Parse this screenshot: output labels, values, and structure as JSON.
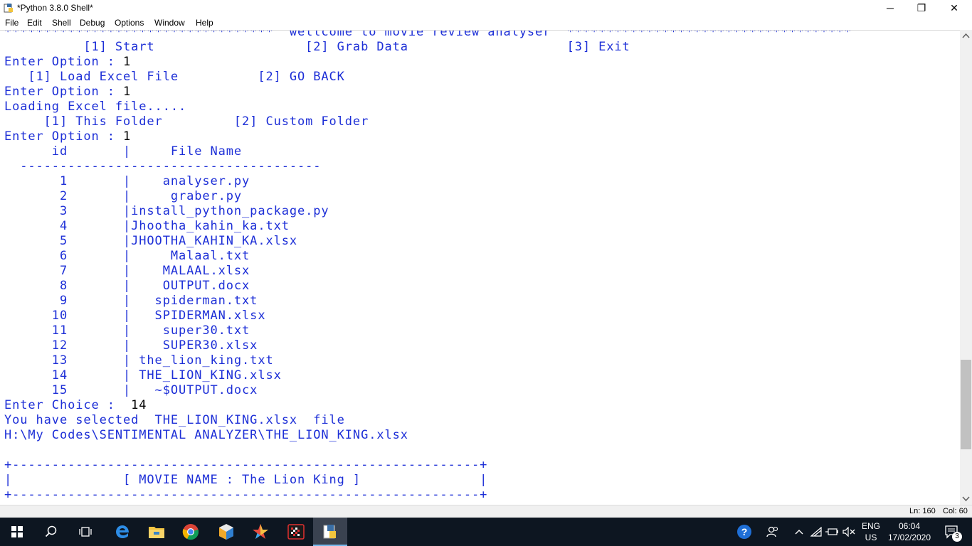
{
  "window": {
    "title": "*Python 3.8.0 Shell*",
    "minimize_glyph": "─",
    "maximize_glyph": "❐",
    "close_glyph": "✕"
  },
  "menu": [
    "File",
    "Edit",
    "Shell",
    "Debug",
    "Options",
    "Window",
    "Help"
  ],
  "shell_lines": [
    {
      "text": "**********************************  wellcome to movie review analyser  ************************************",
      "kind": "out"
    },
    {
      "text": "          [1] Start                   [2] Grab Data                    [3] Exit",
      "kind": "out"
    },
    {
      "text": "Enter Option : ",
      "input": "1",
      "kind": "out"
    },
    {
      "text": "   [1] Load Excel File          [2] GO BACK",
      "kind": "out"
    },
    {
      "text": "Enter Option : ",
      "input": "1",
      "kind": "out"
    },
    {
      "text": "Loading Excel file.....",
      "kind": "out"
    },
    {
      "text": "     [1] This Folder         [2] Custom Folder",
      "kind": "out"
    },
    {
      "text": "Enter Option : ",
      "input": "1",
      "kind": "out"
    },
    {
      "text": "      id       |     File Name",
      "kind": "out"
    },
    {
      "text": "  --------------------------------------",
      "kind": "out"
    },
    {
      "text": "       1       |    analyser.py",
      "kind": "out"
    },
    {
      "text": "       2       |     graber.py",
      "kind": "out"
    },
    {
      "text": "       3       |install_python_package.py",
      "kind": "out"
    },
    {
      "text": "       4       |Jhootha_kahin_ka.txt",
      "kind": "out"
    },
    {
      "text": "       5       |JHOOTHA_KAHIN_KA.xlsx",
      "kind": "out"
    },
    {
      "text": "       6       |     Malaal.txt",
      "kind": "out"
    },
    {
      "text": "       7       |    MALAAL.xlsx",
      "kind": "out"
    },
    {
      "text": "       8       |    OUTPUT.docx",
      "kind": "out"
    },
    {
      "text": "       9       |   spiderman.txt",
      "kind": "out"
    },
    {
      "text": "      10       |   SPIDERMAN.xlsx",
      "kind": "out"
    },
    {
      "text": "      11       |    super30.txt",
      "kind": "out"
    },
    {
      "text": "      12       |    SUPER30.xlsx",
      "kind": "out"
    },
    {
      "text": "      13       | the_lion_king.txt",
      "kind": "out"
    },
    {
      "text": "      14       | THE_LION_KING.xlsx",
      "kind": "out"
    },
    {
      "text": "      15       |   ~$OUTPUT.docx",
      "kind": "out"
    },
    {
      "text": "Enter Choice :  ",
      "input": "14",
      "kind": "out"
    },
    {
      "text": "You have selected  THE_LION_KING.xlsx  file",
      "kind": "out"
    },
    {
      "text": "H:\\My Codes\\SENTIMENTAL ANALYZER\\THE_LION_KING.xlsx",
      "kind": "out"
    },
    {
      "text": "",
      "kind": "out"
    },
    {
      "text": "+-----------------------------------------------------------+",
      "kind": "out"
    },
    {
      "text": "|              [ MOVIE NAME : The Lion King ]               |",
      "kind": "out"
    },
    {
      "text": "+-----------------------------------------------------------+",
      "kind": "out"
    }
  ],
  "status": {
    "ln": "Ln: 160",
    "col": "Col: 60"
  },
  "taskbar": {
    "icons": [
      "windows-start-icon",
      "search-icon",
      "task-view-icon",
      "edge-icon",
      "file-explorer-icon",
      "chrome-icon",
      "app-cube-icon",
      "star-app-icon",
      "checker-app-icon",
      "python-idle-icon"
    ],
    "language": "ENG",
    "region": "US",
    "time": "06:04",
    "date": "17/02/2020",
    "notifications": "3"
  },
  "colors": {
    "output_text": "#1d2fd7",
    "input_text": "#000000",
    "taskbar": "#0d1621",
    "scroll_thumb": "#c1c1c1"
  }
}
